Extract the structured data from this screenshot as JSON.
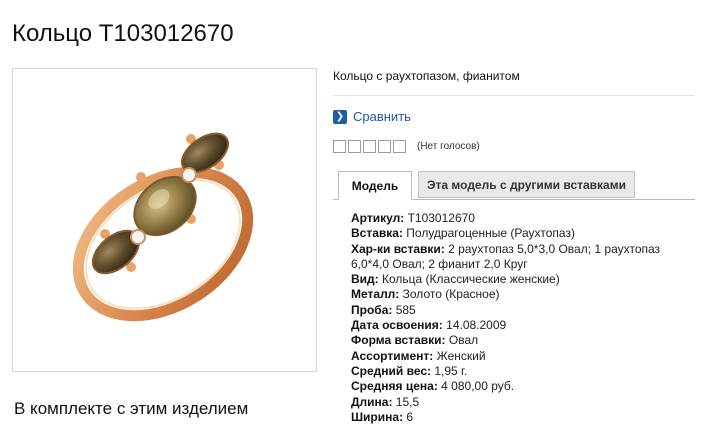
{
  "product": {
    "title": "Кольцо Т103012670",
    "short_description": "Кольцо с раухтопазом, фианитом"
  },
  "compare": {
    "label": "Сравнить",
    "icon": "chevron-right-icon"
  },
  "rating": {
    "value": 0,
    "max": 5,
    "text": "(Нет голосов)"
  },
  "tabs": [
    {
      "label": "Модель",
      "active": true
    },
    {
      "label": "Эта модель с другими вставками",
      "active": false
    }
  ],
  "specs": [
    {
      "label": "Артикул:",
      "value": " Т103012670"
    },
    {
      "label": "Вставка:",
      "value": " Полудрагоценные (Раухтопаз)"
    },
    {
      "label": "Хар-ки вставки:",
      "value": " 2 раухтопаз 5,0*3,0 Овал; 1 раухтопаз 6,0*4,0 Овал; 2 фианит 2,0 Круг"
    },
    {
      "label": "Вид:",
      "value": " Кольца (Классические женские)"
    },
    {
      "label": "Металл:",
      "value": " Золото (Красное)"
    },
    {
      "label": "Проба:",
      "value": " 585"
    },
    {
      "label": "Дата освоения:",
      "value": " 14.08.2009"
    },
    {
      "label": "Форма вставки:",
      "value": " Овал"
    },
    {
      "label": "Ассортимент:",
      "value": " Женский"
    },
    {
      "label": "Средний вес:",
      "value": " 1,95 г."
    },
    {
      "label": "Средняя цена:",
      "value": " 4 080,00 руб."
    },
    {
      "label": "Длина:",
      "value": " 15,5"
    },
    {
      "label": "Ширина:",
      "value": " 6"
    }
  ],
  "kit": {
    "heading": "В комплекте с этим изделием"
  },
  "colors": {
    "link": "#1f57a6",
    "compare_icon_bg": "#1d5fa8",
    "gold": "#d9894e",
    "stone": "#6b5a38"
  }
}
